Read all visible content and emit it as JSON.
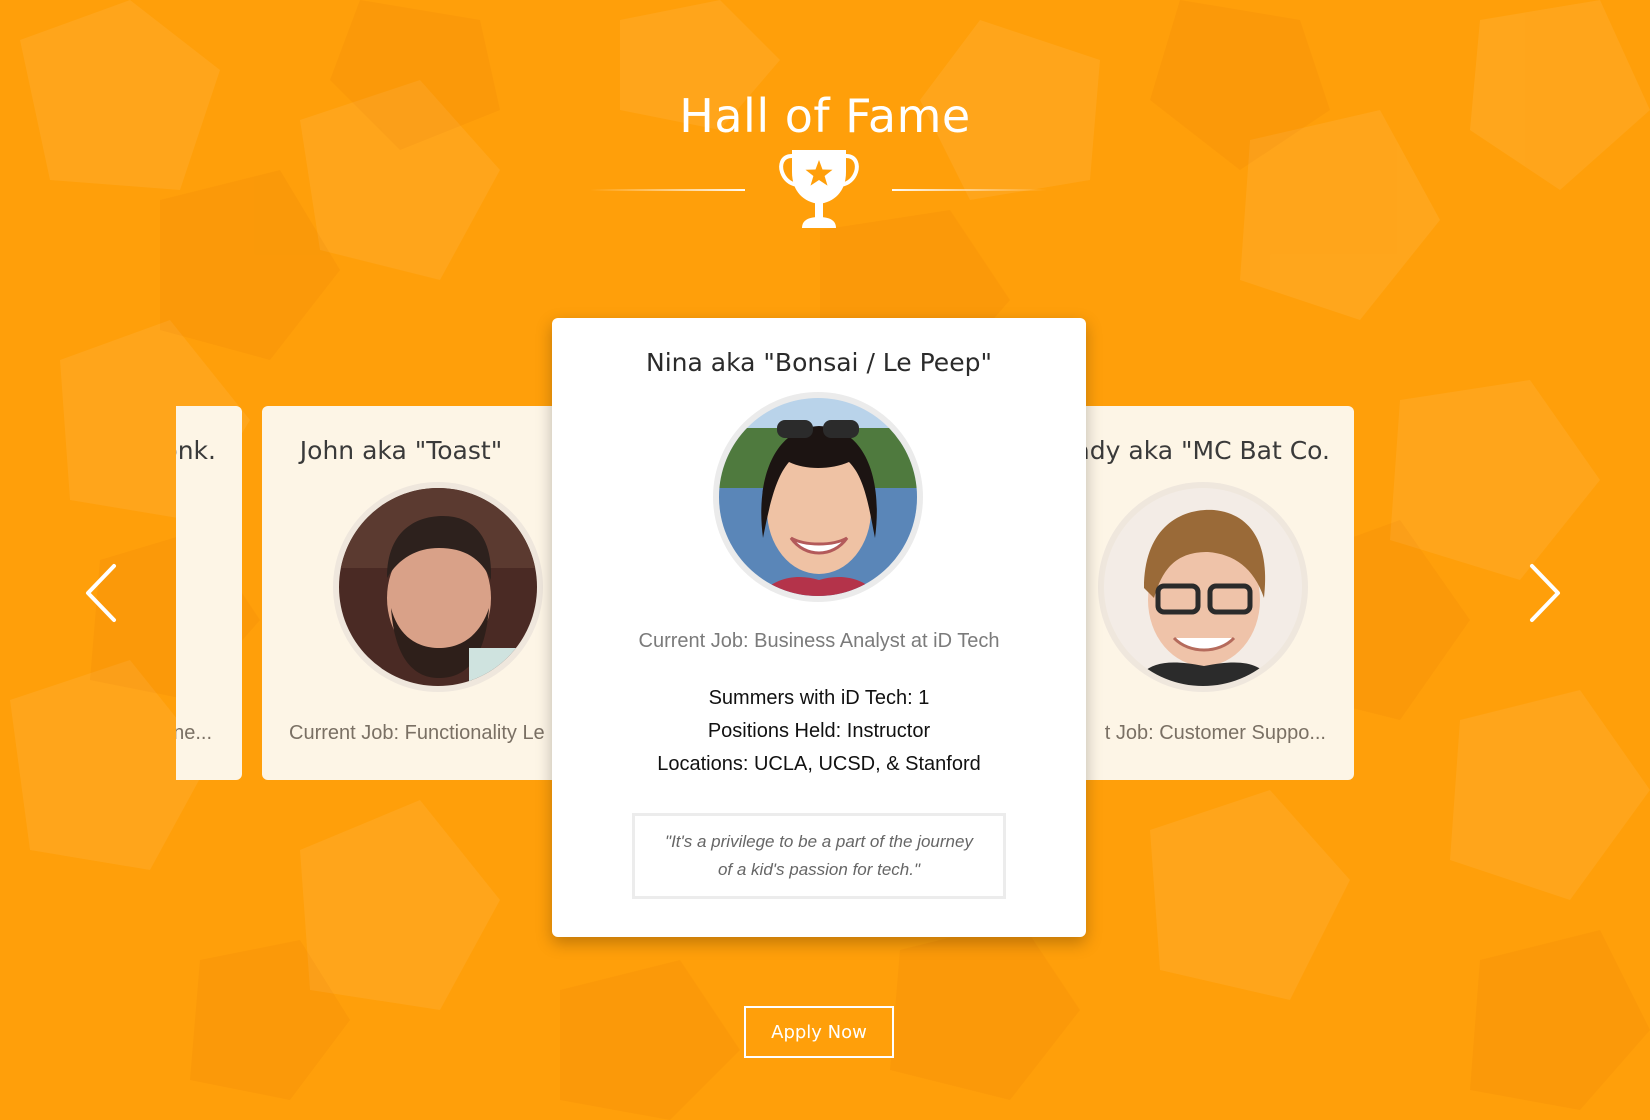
{
  "section": {
    "title": "Hall of Fame",
    "trophy_icon": "trophy-star-icon"
  },
  "colors": {
    "background": "#ff9f0a",
    "card_side": "#fdf5e6",
    "card_featured": "#ffffff"
  },
  "carousel": {
    "prev_icon": "chevron-left-icon",
    "next_icon": "chevron-right-icon",
    "cards": [
      {
        "name": "onk.",
        "job": "ne..."
      },
      {
        "name": "John aka \"Toast\"",
        "job": "Current Job: Functionality Le"
      },
      {
        "name": "Nina aka \"Bonsai / Le Peep\"",
        "job": "Current Job: Business Analyst at iD Tech",
        "summers": "Summers with iD Tech: 1",
        "positions": "Positions Held: Instructor",
        "locations": "Locations: UCLA, UCSD, & Stanford",
        "quote_line1": "\"It's a privilege to be a part of the journey",
        "quote_line2": "of a kid's passion for tech.\""
      },
      {
        "name": "ady aka \"MC Bat Co.",
        "job": "t Job: Customer Suppo..."
      }
    ]
  },
  "cta": {
    "label": "Apply Now"
  }
}
